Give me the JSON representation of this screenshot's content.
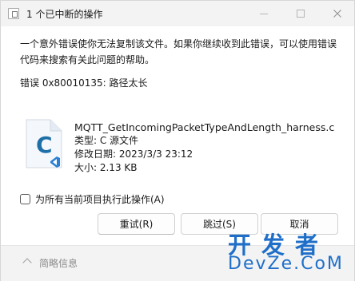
{
  "window": {
    "title": "1 个已中断的操作"
  },
  "dialog": {
    "message": "一个意外错误使你无法复制该文件。如果你继续收到此错误，可以使用错误代码来搜索有关此问题的帮助。",
    "error": "错误 0x80010135: 路径太长"
  },
  "file": {
    "icon": "c-source-file-icon",
    "name": "MQTT_GetIncomingPacketTypeAndLength_harness.c",
    "type": "类型: C 源文件",
    "modified": "修改日期: 2023/3/3 23:12",
    "size": "大小: 2.13 KB"
  },
  "apply_all": {
    "label": "为所有当前项目执行此操作(A)",
    "checked": false
  },
  "buttons": {
    "retry": "重试(R)",
    "skip": "跳过(S)",
    "cancel": "取消"
  },
  "footer": {
    "details_label": "简略信息"
  },
  "watermark": {
    "cn": "开发者",
    "en": "DevZe.CoM"
  },
  "colors": {
    "accent": "#1f6fc9",
    "c_icon": "#1e6fa8",
    "vscode_badge": "#2a7fd3"
  }
}
